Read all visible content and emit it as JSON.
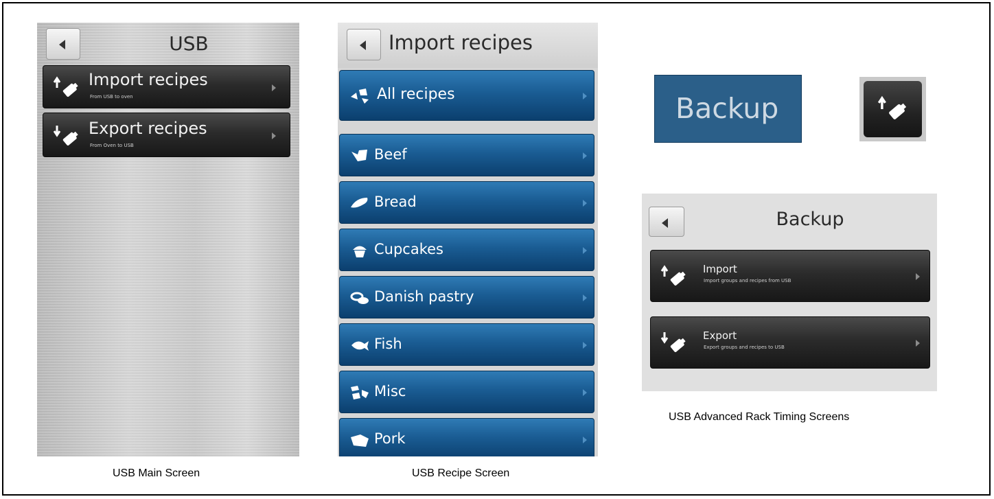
{
  "usb_main": {
    "title": "USB",
    "items": [
      {
        "label": "Import recipes",
        "sub": "From USB to oven",
        "icon": "usb-import-icon"
      },
      {
        "label": "Export recipes",
        "sub": "From Oven to USB",
        "icon": "usb-export-icon"
      }
    ],
    "caption": "USB Main Screen"
  },
  "usb_recipe": {
    "title": "Import recipes",
    "all_label": "All recipes",
    "categories": [
      {
        "label": "Beef",
        "icon": "beef-icon"
      },
      {
        "label": "Bread",
        "icon": "bread-icon"
      },
      {
        "label": "Cupcakes",
        "icon": "cupcake-icon"
      },
      {
        "label": "Danish pastry",
        "icon": "pastry-icon"
      },
      {
        "label": "Fish",
        "icon": "fish-icon"
      },
      {
        "label": "Misc",
        "icon": "misc-icon"
      },
      {
        "label": "Pork",
        "icon": "pork-icon"
      }
    ],
    "caption": "USB Recipe Screen"
  },
  "advanced": {
    "backup_button_label": "Backup",
    "backup_screen": {
      "title": "Backup",
      "items": [
        {
          "label": "Import",
          "sub": "Import groups and recipes from USB",
          "icon": "usb-import-icon"
        },
        {
          "label": "Export",
          "sub": "Export groups and recipes to USB",
          "icon": "usb-export-icon"
        }
      ]
    },
    "caption": "USB Advanced Rack Timing Screens"
  },
  "colors": {
    "blue_row": "#1a5c93",
    "dark_row": "#2b2b2b",
    "backup_button": "#2b5f89"
  }
}
